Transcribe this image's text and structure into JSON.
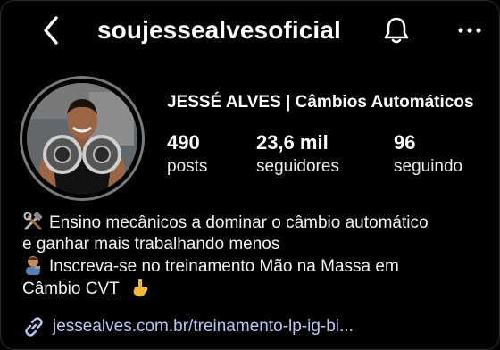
{
  "header": {
    "username": "soujessealvesoficial",
    "back_icon": "chevron-left-icon",
    "bell_icon": "bell-icon",
    "more_icon": "more-horizontal-icon"
  },
  "profile": {
    "full_name": "JESSÉ ALVES | Câmbios Automáticos"
  },
  "stats": [
    {
      "value": "490",
      "label": "posts"
    },
    {
      "value": "23,6 mil",
      "label": "seguidores"
    },
    {
      "value": "96",
      "label": "seguindo"
    }
  ],
  "bio": {
    "line1": "Ensino mecânicos a dominar o câmbio automático",
    "line2": "e ganhar mais trabalhando menos",
    "line3": "Inscreva-se no treinamento Mão na Massa em",
    "line4": "Câmbio CVT"
  },
  "link": {
    "text": "jessealves.com.br/treinamento-lp-ig-bi...",
    "icon": "link-icon"
  },
  "colors": {
    "background": "#000000",
    "text": "#ffffff",
    "link": "#b8c6f2"
  }
}
